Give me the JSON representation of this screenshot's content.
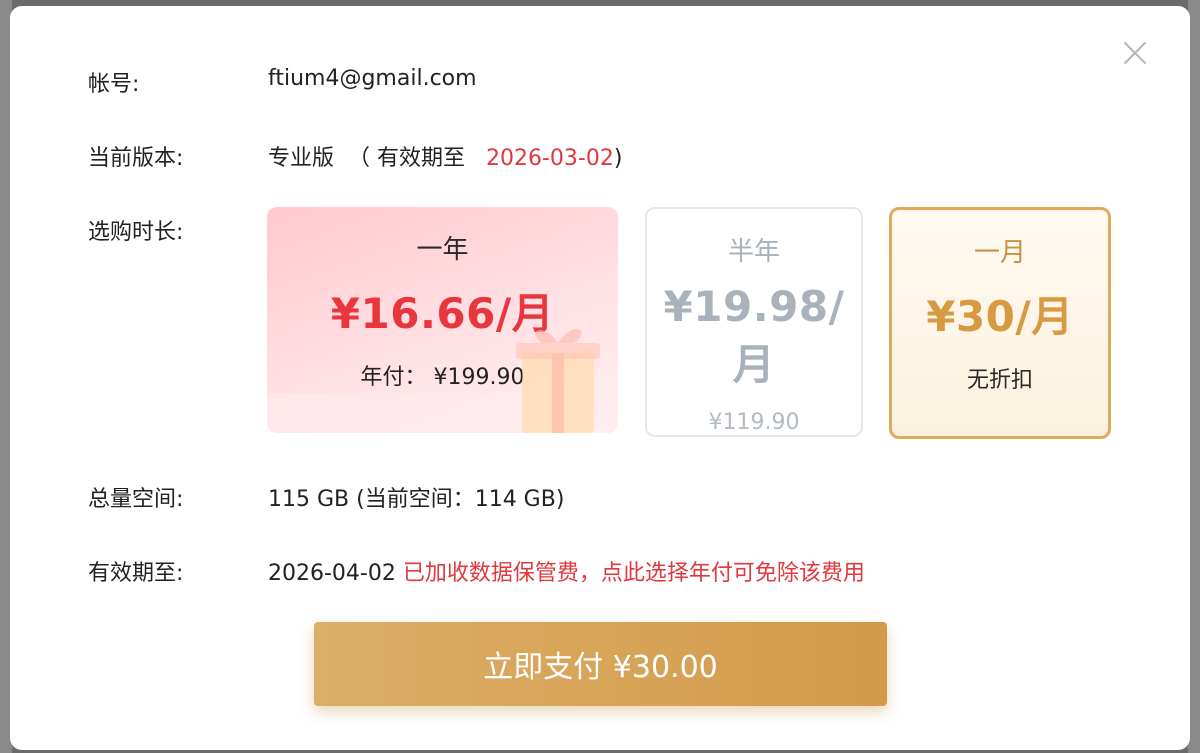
{
  "dialog": {
    "account": {
      "label": "帐号:",
      "value": "ftium4@gmail.com"
    },
    "current_version": {
      "label": "当前版本:",
      "edition": "专业版",
      "open_paren": "（ 有效期至",
      "expiry": "2026-03-02",
      "close_paren": ")"
    },
    "duration": {
      "label": "选购时长:",
      "plans": [
        {
          "title": "一年",
          "price": "¥16.66/月",
          "sub": "年付： ¥199.90",
          "selected": false
        },
        {
          "title": "半年",
          "price": "¥19.98/月",
          "sub": "¥119.90",
          "selected": false
        },
        {
          "title": "一月",
          "price": "¥30/月",
          "sub": "无折扣",
          "selected": true
        }
      ]
    },
    "storage": {
      "label": "总量空间:",
      "value": "115 GB (当前空间：114 GB)"
    },
    "valid_until": {
      "label": "有效期至:",
      "date": "2026-04-02",
      "notice": "已加收数据保管费，点此选择年付可免除该费用"
    },
    "pay_button": "立即支付 ¥30.00"
  },
  "colors": {
    "accent_red": "#e0383e",
    "gold": "#d89a40",
    "pay_button": "#d6a456"
  },
  "icons": {
    "close": "close-icon",
    "gift": "gift-icon"
  }
}
